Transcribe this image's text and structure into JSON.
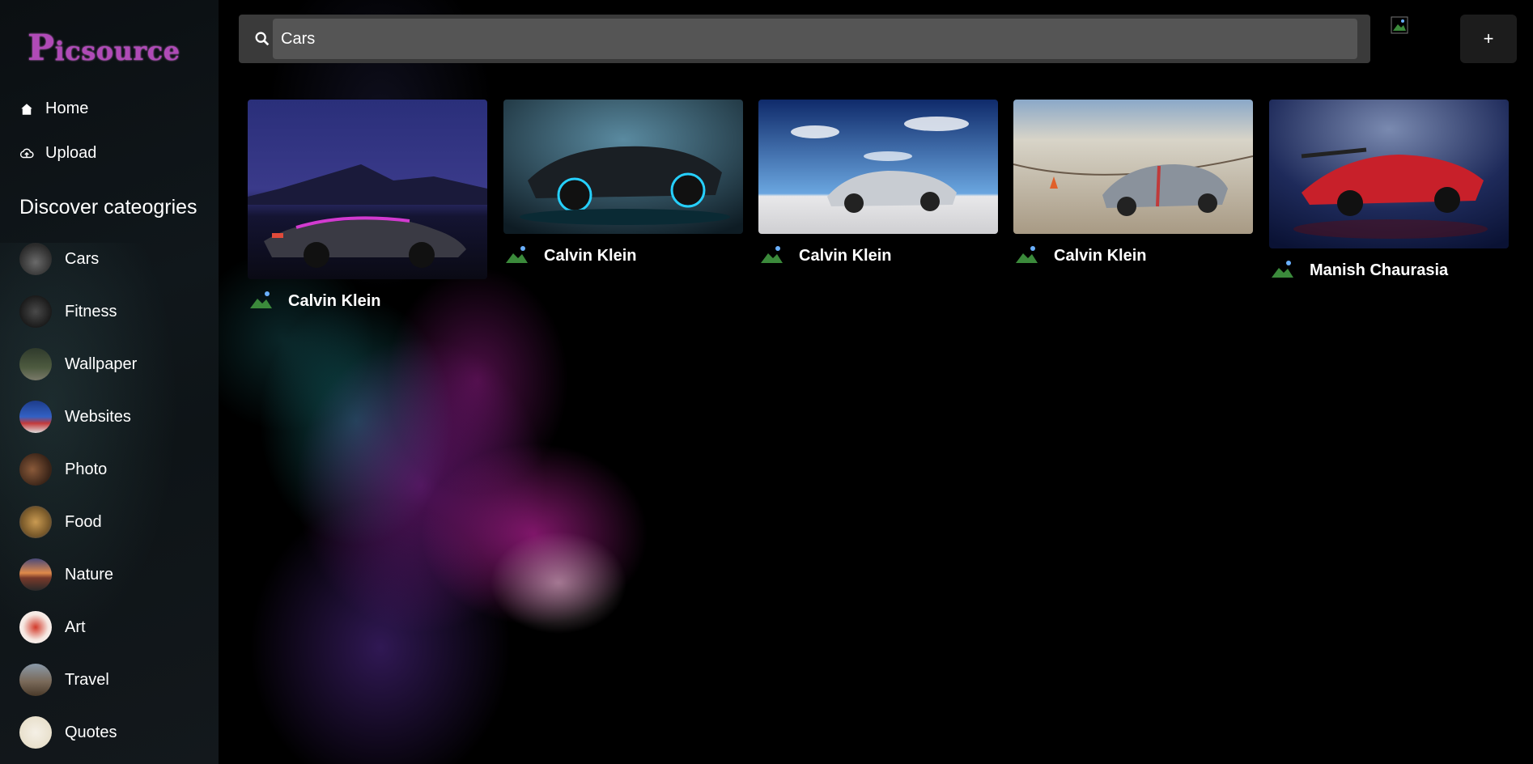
{
  "app": {
    "logo_text_cap": "P",
    "logo_text_rest": "icsource"
  },
  "nav": [
    {
      "label": "Home",
      "icon": "home-icon"
    },
    {
      "label": "Upload",
      "icon": "upload-icon"
    }
  ],
  "categories_title": "Discover cateogries",
  "categories": [
    {
      "label": "Cars"
    },
    {
      "label": "Fitness"
    },
    {
      "label": "Wallpaper"
    },
    {
      "label": "Websites"
    },
    {
      "label": "Photo"
    },
    {
      "label": "Food"
    },
    {
      "label": "Nature"
    },
    {
      "label": "Art"
    },
    {
      "label": "Travel"
    },
    {
      "label": "Quotes"
    }
  ],
  "search": {
    "value": "Cars",
    "icon": "search-icon"
  },
  "add_button": {
    "label": "+"
  },
  "pins": [
    {
      "author": "Calvin Klein"
    },
    {
      "author": "Calvin Klein"
    },
    {
      "author": "Calvin Klein"
    },
    {
      "author": "Calvin Klein"
    },
    {
      "author": "Manish Chaurasia"
    }
  ],
  "colors": {
    "accent": "#b04ab7",
    "background": "#000000",
    "search_bar": "#555555"
  }
}
